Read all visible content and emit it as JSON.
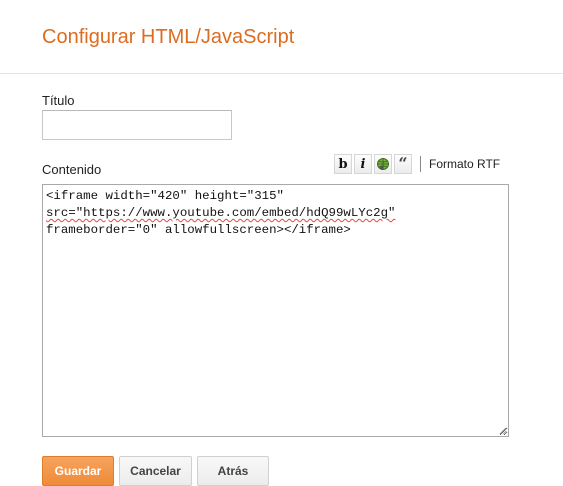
{
  "dialog": {
    "title": "Configurar HTML/JavaScript"
  },
  "form": {
    "title_label": "Título",
    "title_value": "",
    "content_label": "Contenido",
    "content_lines": [
      "<iframe width=\"420\" height=\"315\"",
      "src=\"https://www.youtube.com/embed/hdQ99wLYc2g\"",
      "frameborder=\"0\" allowfullscreen></iframe>"
    ]
  },
  "toolbar": {
    "bold_label": "b",
    "italic_label": "i",
    "link_icon": "link-globe-icon",
    "quote_label": "“",
    "rtf_label": "Formato RTF"
  },
  "actions": {
    "save_label": "Guardar",
    "cancel_label": "Cancelar",
    "back_label": "Atrás"
  },
  "colors": {
    "title": "#dd6c1f",
    "primary_button": "#f0903e",
    "spellcheck_underline": "#e04848"
  }
}
